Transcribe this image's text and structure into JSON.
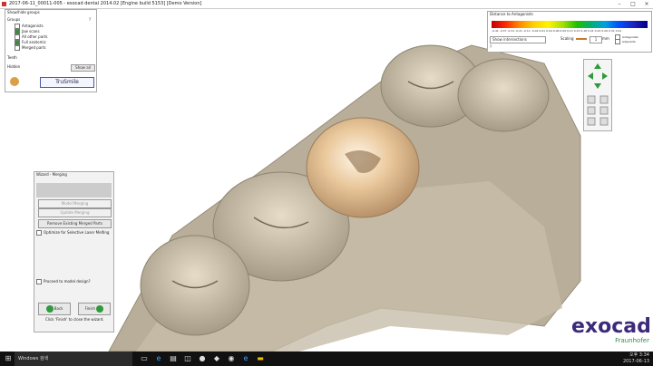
{
  "window": {
    "title": "2017-06-11_00011-005 - exocad dental 2014.02 [Engine build 5153] [Demo Version]",
    "min": "–",
    "max": "□",
    "close": "×"
  },
  "groups_panel": {
    "title": "Show/hide groups",
    "groups_label": "Groups",
    "help": "?",
    "items": [
      {
        "label": "Antagonists",
        "checked": false
      },
      {
        "label": "Jaw scans",
        "checked": true
      },
      {
        "label": "All other parts",
        "checked": false
      },
      {
        "label": "Full anatomic",
        "checked": true
      },
      {
        "label": "Merged parts",
        "checked": false
      }
    ],
    "teeth_label": "Teeth",
    "hidden_label": "Hidden",
    "show_all": "Show all",
    "trusmile": "TruSmile"
  },
  "distance_panel": {
    "title": "Distance to Antagonists",
    "scale_labels": [
      "-0.41",
      "-0.37",
      "-0.31",
      "-0.21",
      "-0.11",
      "-0.02",
      "0.01",
      "0.04",
      "0.06",
      "0.09",
      "0.13",
      "0.15",
      "0.18",
      "0.21",
      "0.23",
      "0.26",
      "0.31",
      "0.41"
    ],
    "show_intersections": "Show intersections",
    "scaling": "Scaling",
    "scaling_value": "1",
    "unit": "mm",
    "antagonists": "Antagonists",
    "adjacents": "Adjacents",
    "help": "?"
  },
  "wizard": {
    "title": "Wizard - Merging",
    "btn_model_merging": "Model Merging",
    "btn_update_merging": "Update Merging",
    "btn_remove": "Remove Existing Merged Parts",
    "optimize": "Optimize for Selective Laser Melting",
    "proceed": "Proceed to model design?",
    "back": "Back",
    "finish": "Finish",
    "hint": "Click 'Finish' to close the wizard.",
    "accent": "#2e9a3b"
  },
  "logo": {
    "brand": "exocad",
    "partner": "Fraunhofer"
  },
  "taskbar": {
    "search": "Windows 검색",
    "time": "오후 3:34",
    "date": "2017-06-13"
  }
}
